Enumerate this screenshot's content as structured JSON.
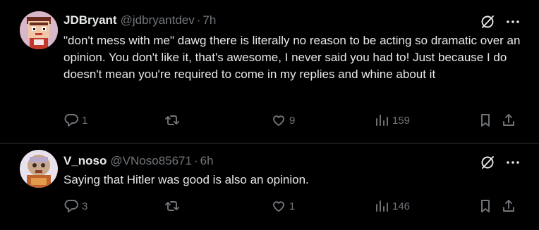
{
  "tweets": [
    {
      "name": "JDBryant",
      "handle": "@jdbryantdev",
      "separator": "·",
      "time": "7h",
      "text": "\"don't mess with me\" dawg there is literally no reason to be acting so dramatic over an opinion. You don't like it, that's awesome, I never said you had to! Just because I do doesn't mean you're required to come in my replies and whine about it",
      "replies": "1",
      "retweets": "",
      "likes": "9",
      "views": "159"
    },
    {
      "name": "V_noso",
      "handle": "@VNoso85671",
      "separator": "·",
      "time": "6h",
      "text": "Saying that Hitler was good is also an opinion.",
      "replies": "3",
      "retweets": "",
      "likes": "1",
      "views": "146"
    }
  ],
  "icons": {
    "reply": "speech-bubble-icon",
    "retweet": "retweet-arrows-icon",
    "like": "heart-icon",
    "views": "bar-chart-icon",
    "bookmark": "bookmark-icon",
    "share": "share-upload-icon",
    "grok": "grok-slash-icon",
    "more": "more-dots-icon"
  },
  "colors": {
    "background": "#000000",
    "text": "#e7e9ea",
    "muted": "#71767b",
    "divider": "#2f3336"
  }
}
